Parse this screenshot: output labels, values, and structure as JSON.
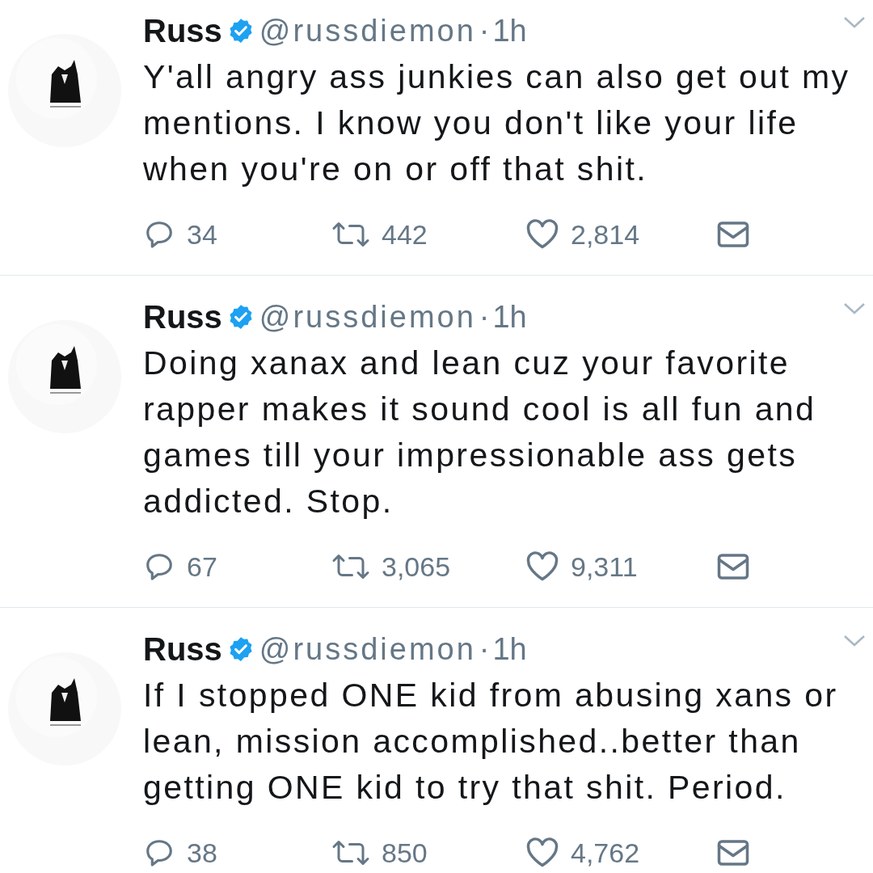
{
  "tweets": [
    {
      "name": "Russ",
      "verified": true,
      "handle": "@russdiemon",
      "separator": "·",
      "time": "1h",
      "text": "Y'all angry ass junkies can also get out my mentions. I know you don't like your life when you're on or off that shit.",
      "replies": "34",
      "retweets": "442",
      "likes": "2,814"
    },
    {
      "name": "Russ",
      "verified": true,
      "handle": "@russdiemon",
      "separator": "·",
      "time": "1h",
      "text": "Doing xanax and lean cuz your favorite rapper makes it sound cool is all fun and games till your impressionable ass gets addicted. Stop.",
      "replies": "67",
      "retweets": "3,065",
      "likes": "9,311"
    },
    {
      "name": "Russ",
      "verified": true,
      "handle": "@russdiemon",
      "separator": "·",
      "time": "1h",
      "text": "If I stopped ONE kid from abusing xans or lean, mission accomplished..better than getting ONE kid to try that shit. Period.",
      "replies": "38",
      "retweets": "850",
      "likes": "4,762"
    }
  ]
}
